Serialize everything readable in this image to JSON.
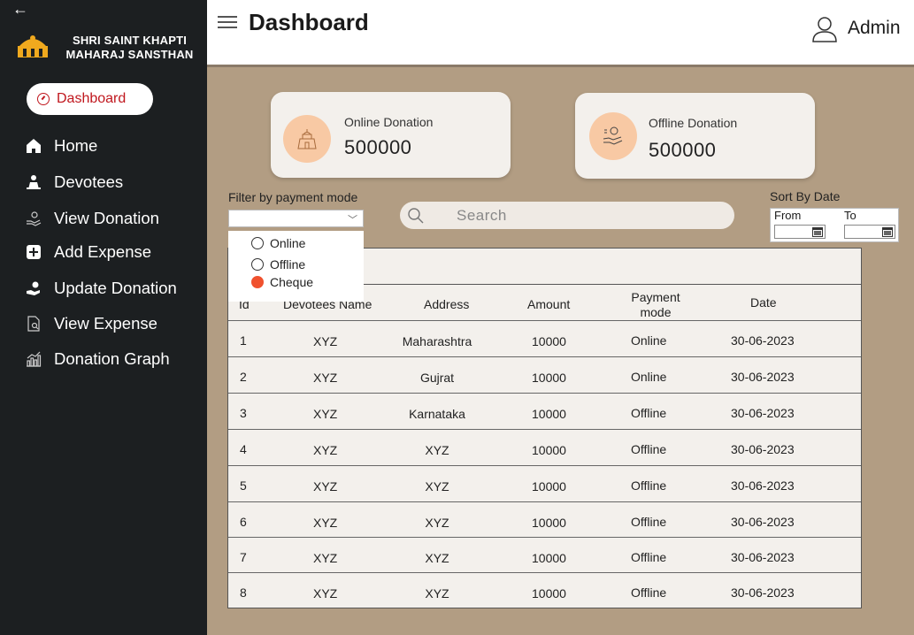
{
  "sidebar": {
    "org_name": "SHRI SAINT KHAPTI MAHARAJ SANSTHAN",
    "active_item": "Dashboard",
    "items": [
      {
        "label": "Home",
        "icon": "home-icon"
      },
      {
        "label": "Devotees",
        "icon": "devotee-icon"
      },
      {
        "label": "View Donation",
        "icon": "donation-hand-icon"
      },
      {
        "label": "Add Expense",
        "icon": "plus-square-icon"
      },
      {
        "label": "Update Donation",
        "icon": "update-donation-icon"
      },
      {
        "label": "View Expense",
        "icon": "document-search-icon"
      },
      {
        "label": "Donation Graph",
        "icon": "bar-graph-icon"
      }
    ]
  },
  "header": {
    "title": "Dashboard",
    "user_label": "Admin"
  },
  "cards": {
    "online": {
      "label": "Online Donation",
      "value": "500000"
    },
    "offline": {
      "label": "Offline Donation",
      "value": "500000"
    }
  },
  "filter": {
    "label": "Filter by payment mode",
    "options": [
      "Online",
      "Offline",
      "Cheque"
    ],
    "selected": "Cheque"
  },
  "search": {
    "placeholder": "Search"
  },
  "sort": {
    "label": "Sort By Date",
    "from_label": "From",
    "to_label": "To"
  },
  "table": {
    "headers": [
      "Id",
      "Devotees Name",
      "Address",
      "Amount",
      "Payment mode",
      "Date"
    ],
    "rows": [
      [
        "1",
        "XYZ",
        "Maharashtra",
        "10000",
        "Online",
        "30-06-2023"
      ],
      [
        "2",
        "XYZ",
        "Gujrat",
        "10000",
        "Online",
        "30-06-2023"
      ],
      [
        "3",
        "XYZ",
        "Karnataka",
        "10000",
        "Offline",
        "30-06-2023"
      ],
      [
        "4",
        "XYZ",
        "XYZ",
        "10000",
        "Offline",
        "30-06-2023"
      ],
      [
        "5",
        "XYZ",
        "XYZ",
        "10000",
        "Offline",
        "30-06-2023"
      ],
      [
        "6",
        "XYZ",
        "XYZ",
        "10000",
        "Offline",
        "30-06-2023"
      ],
      [
        "7",
        "XYZ",
        "XYZ",
        "10000",
        "Offline",
        "30-06-2023"
      ],
      [
        "8",
        "XYZ",
        "XYZ",
        "10000",
        "Offline",
        "30-06-2023"
      ]
    ]
  },
  "colors": {
    "sidebar_bg": "#1c1f21",
    "page_bg": "#b29d83",
    "accent_red": "#c0171e",
    "radio_selected": "#f0512e",
    "card_icon_bg": "#f8c9a4"
  }
}
